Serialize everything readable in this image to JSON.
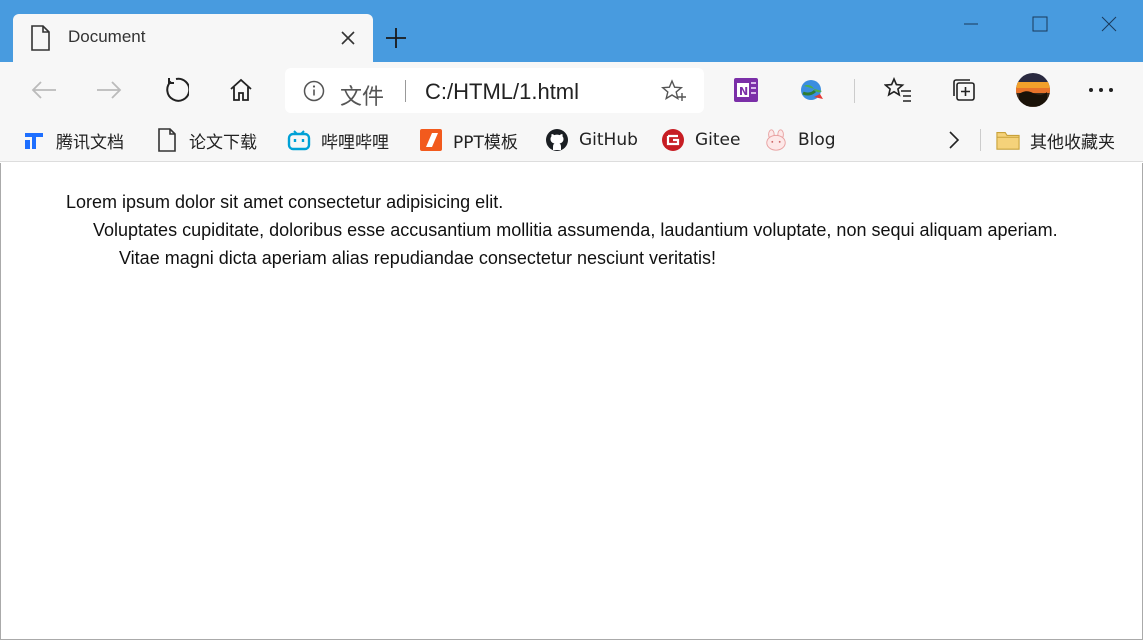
{
  "tab": {
    "title": "Document",
    "icon": "document-icon"
  },
  "address_bar": {
    "scheme_label": "文件",
    "url": "C:/HTML/1.html"
  },
  "bookmarks": [
    {
      "label": "腾讯文档",
      "icon": "tencent-docs-icon"
    },
    {
      "label": "论文下载",
      "icon": "document-icon"
    },
    {
      "label": "哔哩哔哩",
      "icon": "bilibili-icon"
    },
    {
      "label": "PPT模板",
      "icon": "ppt-icon"
    },
    {
      "label": "GitHub",
      "icon": "github-icon"
    },
    {
      "label": "Gitee",
      "icon": "gitee-icon"
    },
    {
      "label": "Blog",
      "icon": "blog-rabbit-icon"
    }
  ],
  "other_favorites": {
    "label": "其他收藏夹",
    "icon": "folder-icon"
  },
  "content": {
    "lines": [
      "Lorem ipsum dolor sit amet consectetur adipisicing elit.",
      "Voluptates cupiditate, doloribus esse accusantium mollitia assumenda, laudantium voluptate, non sequi aliquam aperiam.",
      "Vitae magni dicta aperiam alias repudiandae consectetur nesciunt veritatis!"
    ]
  },
  "colors": {
    "titlebar": "#489bdf",
    "toolbar": "#f7f7f7",
    "accent": "#0078d7"
  }
}
